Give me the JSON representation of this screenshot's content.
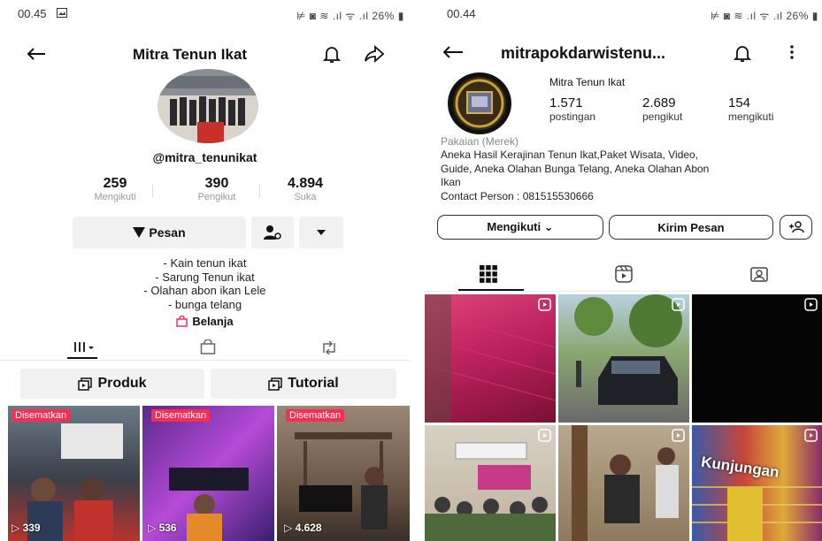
{
  "left": {
    "status": {
      "time": "00.45",
      "right": "⊭ ◙ ≋ .ıl ᯤ .ıl 26% ▮"
    },
    "header": {
      "title": "Mitra Tenun Ikat"
    },
    "username": "@mitra_tenunikat",
    "stats": [
      {
        "value": "259",
        "label": "Mengikuti"
      },
      {
        "value": "390",
        "label": "Pengikut"
      },
      {
        "value": "4.894",
        "label": "Suka"
      }
    ],
    "actions": {
      "message_label": "Pesan"
    },
    "bio": [
      "- Kain tenun ikat",
      "- Sarung Tenun ikat",
      "- Olahan abon ikan Lele",
      "- bunga telang"
    ],
    "shop_label": "Belanja",
    "tabs": [
      {
        "label": "Produk"
      },
      {
        "label": "Tutorial"
      }
    ],
    "videos": [
      {
        "badge": "Disematkan",
        "views": "339"
      },
      {
        "badge": "Disematkan",
        "views": "536"
      },
      {
        "badge": "Disematkan",
        "views": "4.628"
      }
    ]
  },
  "right": {
    "status": {
      "time": "00.44",
      "right": "⊭ ◙ ≋ .ıl ᯤ .ıl 26% ▮"
    },
    "header": {
      "username": "mitrapokdarwistenu..."
    },
    "profile_name": "Mitra Tenun Ikat",
    "stats": [
      {
        "value": "1.571",
        "label": "postingan"
      },
      {
        "value": "2.689",
        "label": "pengikut"
      },
      {
        "value": "154",
        "label": "mengikuti"
      }
    ],
    "category": "Pakaian (Merek)",
    "bio_lines": [
      "Aneka Hasil Kerajinan Tenun Ikat,Paket Wisata, Video,",
      "Guide, Aneka Olahan Bunga Telang, Aneka Olahan Abon",
      "Ikan",
      "Contact Person : 081515530666"
    ],
    "buttons": {
      "following": "Mengikuti ⌄",
      "message": "Kirim Pesan"
    },
    "grid_overlay_text": "Kunjungan"
  },
  "colors": {
    "tiktok_red": "#fe2c55",
    "text": "#111111",
    "muted": "#999999",
    "button_gray": "#f1f1f2"
  }
}
